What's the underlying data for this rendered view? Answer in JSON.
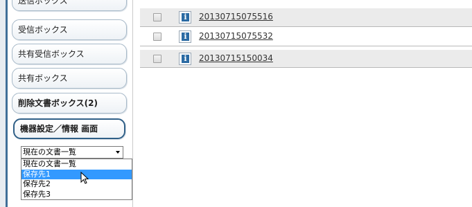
{
  "sidebar": {
    "items": [
      {
        "label": "送信ボックス"
      },
      {
        "label": "受信ボックス"
      },
      {
        "label": "共有受信ボックス"
      },
      {
        "label": "共有ボックス"
      },
      {
        "label": "削除文書ボックス(2)"
      },
      {
        "label": "機器設定／情報 画面"
      }
    ],
    "select": {
      "value": "現在の文書一覧",
      "options": [
        "現在の文書一覧",
        "保存先1",
        "保存先2",
        "保存先3"
      ],
      "highlighted": "保存先1"
    }
  },
  "documents": [
    {
      "name": "20130715075516"
    },
    {
      "name": "20130715075532"
    },
    {
      "name": "20130715150034"
    }
  ],
  "icons": {
    "info": "i"
  },
  "colors": {
    "selection": "#3399ff",
    "nav_active_border": "#2f5f87",
    "info_icon": "#2a6aa3"
  }
}
